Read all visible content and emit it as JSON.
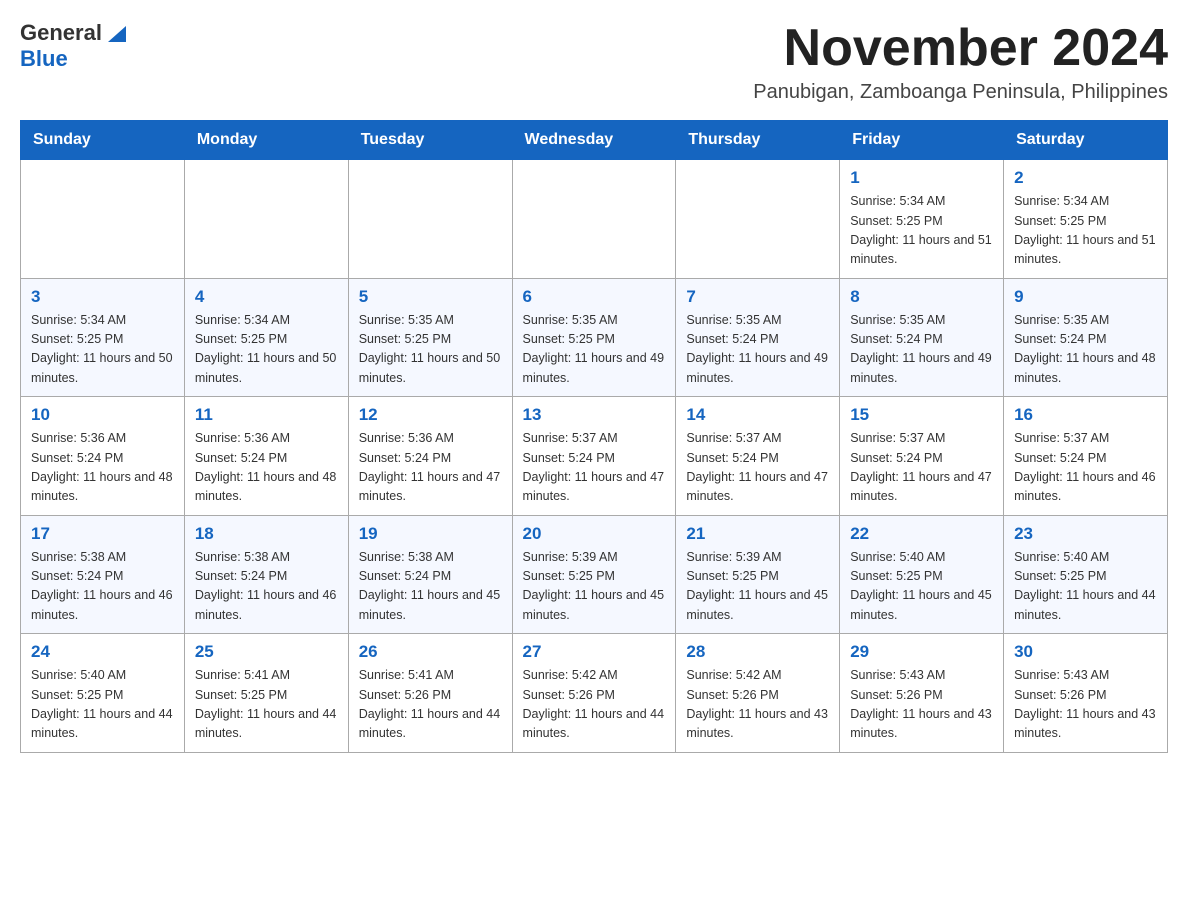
{
  "logo": {
    "text_general": "General",
    "text_blue": "Blue"
  },
  "header": {
    "month_title": "November 2024",
    "location": "Panubigan, Zamboanga Peninsula, Philippines"
  },
  "days_of_week": [
    "Sunday",
    "Monday",
    "Tuesday",
    "Wednesday",
    "Thursday",
    "Friday",
    "Saturday"
  ],
  "weeks": [
    [
      {
        "day": "",
        "sunrise": "",
        "sunset": "",
        "daylight": ""
      },
      {
        "day": "",
        "sunrise": "",
        "sunset": "",
        "daylight": ""
      },
      {
        "day": "",
        "sunrise": "",
        "sunset": "",
        "daylight": ""
      },
      {
        "day": "",
        "sunrise": "",
        "sunset": "",
        "daylight": ""
      },
      {
        "day": "",
        "sunrise": "",
        "sunset": "",
        "daylight": ""
      },
      {
        "day": "1",
        "sunrise": "Sunrise: 5:34 AM",
        "sunset": "Sunset: 5:25 PM",
        "daylight": "Daylight: 11 hours and 51 minutes."
      },
      {
        "day": "2",
        "sunrise": "Sunrise: 5:34 AM",
        "sunset": "Sunset: 5:25 PM",
        "daylight": "Daylight: 11 hours and 51 minutes."
      }
    ],
    [
      {
        "day": "3",
        "sunrise": "Sunrise: 5:34 AM",
        "sunset": "Sunset: 5:25 PM",
        "daylight": "Daylight: 11 hours and 50 minutes."
      },
      {
        "day": "4",
        "sunrise": "Sunrise: 5:34 AM",
        "sunset": "Sunset: 5:25 PM",
        "daylight": "Daylight: 11 hours and 50 minutes."
      },
      {
        "day": "5",
        "sunrise": "Sunrise: 5:35 AM",
        "sunset": "Sunset: 5:25 PM",
        "daylight": "Daylight: 11 hours and 50 minutes."
      },
      {
        "day": "6",
        "sunrise": "Sunrise: 5:35 AM",
        "sunset": "Sunset: 5:25 PM",
        "daylight": "Daylight: 11 hours and 49 minutes."
      },
      {
        "day": "7",
        "sunrise": "Sunrise: 5:35 AM",
        "sunset": "Sunset: 5:24 PM",
        "daylight": "Daylight: 11 hours and 49 minutes."
      },
      {
        "day": "8",
        "sunrise": "Sunrise: 5:35 AM",
        "sunset": "Sunset: 5:24 PM",
        "daylight": "Daylight: 11 hours and 49 minutes."
      },
      {
        "day": "9",
        "sunrise": "Sunrise: 5:35 AM",
        "sunset": "Sunset: 5:24 PM",
        "daylight": "Daylight: 11 hours and 48 minutes."
      }
    ],
    [
      {
        "day": "10",
        "sunrise": "Sunrise: 5:36 AM",
        "sunset": "Sunset: 5:24 PM",
        "daylight": "Daylight: 11 hours and 48 minutes."
      },
      {
        "day": "11",
        "sunrise": "Sunrise: 5:36 AM",
        "sunset": "Sunset: 5:24 PM",
        "daylight": "Daylight: 11 hours and 48 minutes."
      },
      {
        "day": "12",
        "sunrise": "Sunrise: 5:36 AM",
        "sunset": "Sunset: 5:24 PM",
        "daylight": "Daylight: 11 hours and 47 minutes."
      },
      {
        "day": "13",
        "sunrise": "Sunrise: 5:37 AM",
        "sunset": "Sunset: 5:24 PM",
        "daylight": "Daylight: 11 hours and 47 minutes."
      },
      {
        "day": "14",
        "sunrise": "Sunrise: 5:37 AM",
        "sunset": "Sunset: 5:24 PM",
        "daylight": "Daylight: 11 hours and 47 minutes."
      },
      {
        "day": "15",
        "sunrise": "Sunrise: 5:37 AM",
        "sunset": "Sunset: 5:24 PM",
        "daylight": "Daylight: 11 hours and 47 minutes."
      },
      {
        "day": "16",
        "sunrise": "Sunrise: 5:37 AM",
        "sunset": "Sunset: 5:24 PM",
        "daylight": "Daylight: 11 hours and 46 minutes."
      }
    ],
    [
      {
        "day": "17",
        "sunrise": "Sunrise: 5:38 AM",
        "sunset": "Sunset: 5:24 PM",
        "daylight": "Daylight: 11 hours and 46 minutes."
      },
      {
        "day": "18",
        "sunrise": "Sunrise: 5:38 AM",
        "sunset": "Sunset: 5:24 PM",
        "daylight": "Daylight: 11 hours and 46 minutes."
      },
      {
        "day": "19",
        "sunrise": "Sunrise: 5:38 AM",
        "sunset": "Sunset: 5:24 PM",
        "daylight": "Daylight: 11 hours and 45 minutes."
      },
      {
        "day": "20",
        "sunrise": "Sunrise: 5:39 AM",
        "sunset": "Sunset: 5:25 PM",
        "daylight": "Daylight: 11 hours and 45 minutes."
      },
      {
        "day": "21",
        "sunrise": "Sunrise: 5:39 AM",
        "sunset": "Sunset: 5:25 PM",
        "daylight": "Daylight: 11 hours and 45 minutes."
      },
      {
        "day": "22",
        "sunrise": "Sunrise: 5:40 AM",
        "sunset": "Sunset: 5:25 PM",
        "daylight": "Daylight: 11 hours and 45 minutes."
      },
      {
        "day": "23",
        "sunrise": "Sunrise: 5:40 AM",
        "sunset": "Sunset: 5:25 PM",
        "daylight": "Daylight: 11 hours and 44 minutes."
      }
    ],
    [
      {
        "day": "24",
        "sunrise": "Sunrise: 5:40 AM",
        "sunset": "Sunset: 5:25 PM",
        "daylight": "Daylight: 11 hours and 44 minutes."
      },
      {
        "day": "25",
        "sunrise": "Sunrise: 5:41 AM",
        "sunset": "Sunset: 5:25 PM",
        "daylight": "Daylight: 11 hours and 44 minutes."
      },
      {
        "day": "26",
        "sunrise": "Sunrise: 5:41 AM",
        "sunset": "Sunset: 5:26 PM",
        "daylight": "Daylight: 11 hours and 44 minutes."
      },
      {
        "day": "27",
        "sunrise": "Sunrise: 5:42 AM",
        "sunset": "Sunset: 5:26 PM",
        "daylight": "Daylight: 11 hours and 44 minutes."
      },
      {
        "day": "28",
        "sunrise": "Sunrise: 5:42 AM",
        "sunset": "Sunset: 5:26 PM",
        "daylight": "Daylight: 11 hours and 43 minutes."
      },
      {
        "day": "29",
        "sunrise": "Sunrise: 5:43 AM",
        "sunset": "Sunset: 5:26 PM",
        "daylight": "Daylight: 11 hours and 43 minutes."
      },
      {
        "day": "30",
        "sunrise": "Sunrise: 5:43 AM",
        "sunset": "Sunset: 5:26 PM",
        "daylight": "Daylight: 11 hours and 43 minutes."
      }
    ]
  ]
}
